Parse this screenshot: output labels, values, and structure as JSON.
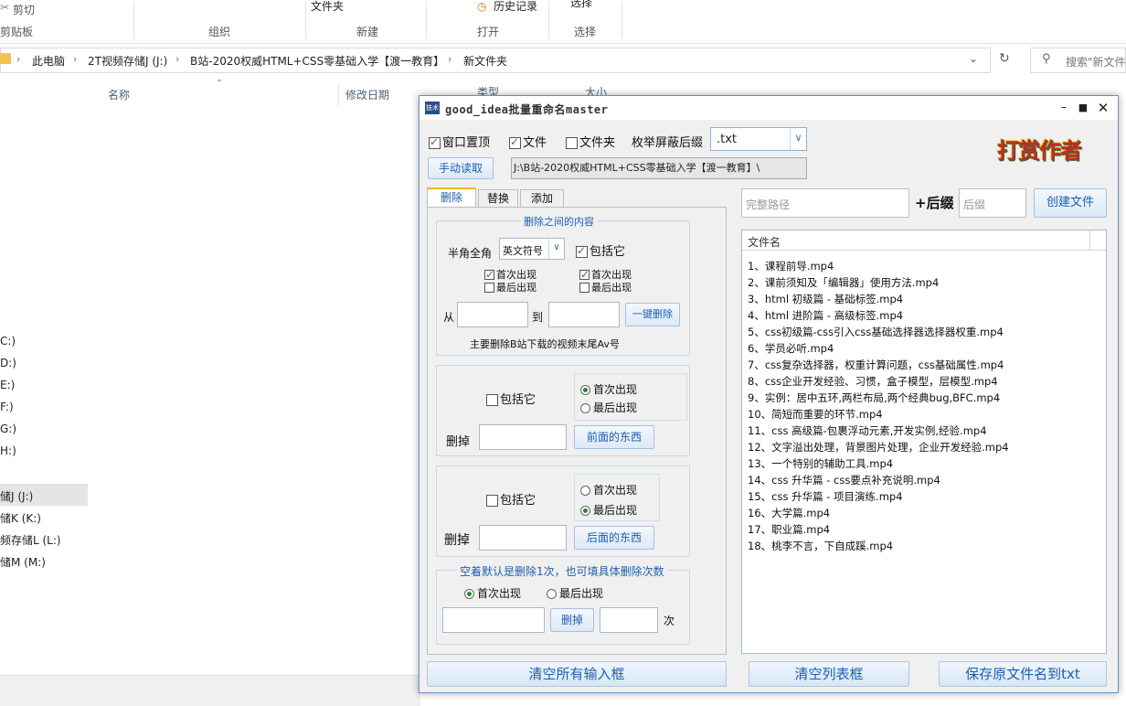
{
  "ribbon": {
    "cut": "剪切",
    "folder": "文件夹",
    "history": "历史记录",
    "select_all": "选择",
    "groups": [
      "剪贴板",
      "组织",
      "新建",
      "打开",
      "选择"
    ]
  },
  "address": {
    "crumbs": [
      "此电脑",
      "2T视频存储J (J:)",
      "B站-2020权威HTML+CSS零基础入学【渡一教育】",
      "新文件夹"
    ],
    "search_placeholder": "搜索\"新文件"
  },
  "columns": {
    "name": "名称",
    "modified": "修改日期",
    "type": "类型",
    "size": "大小"
  },
  "drives": [
    "C:)",
    "D:)",
    "E:)",
    "F:)",
    "G:)",
    "H:)",
    "储J (J:)",
    "储K (K:)",
    "频存储L (L:)",
    "储M (M:)"
  ],
  "window": {
    "title": "good_idea批量重命名master",
    "icon_text": "技术",
    "pin_label": "窗口置顶",
    "file_label": "文件",
    "folder_label": "文件夹",
    "suffix_label": "枚举屏蔽后缀",
    "suffix_value": ".txt",
    "manual_read": "手动读取",
    "path_value": "J:\\B站-2020权威HTML+CSS零基础入学【渡一教育】\\",
    "reward_label": "打赏作者",
    "full_path_placeholder": "完整路径",
    "plus_suffix": "+后缀",
    "suffix_placeholder": "后缀",
    "create_file": "创建文件",
    "tabs": [
      "删除",
      "替换",
      "添加"
    ],
    "g1": {
      "title": "删除之间的内容",
      "half_full": "半角全角",
      "symbol_option": "英文符号",
      "include_it": "包括它",
      "first1": "首次出现",
      "last1": "最后出现",
      "first2": "首次出现",
      "last2": "最后出现",
      "from": "从",
      "to": "到",
      "one_click": "一键删除",
      "note": "主要删除B站下载的视频末尾Av号"
    },
    "g2": {
      "include_it": "包括它",
      "first": "首次出现",
      "last": "最后出现",
      "delete": "删掉",
      "button": "前面的东西"
    },
    "g3": {
      "include_it": "包括它",
      "first": "首次出现",
      "last": "最后出现",
      "delete": "删掉",
      "button": "后面的东西"
    },
    "g4": {
      "title": "空着默认是删除1次，也可填具体删除次数",
      "first": "首次出现",
      "last": "最后出现",
      "button": "删掉",
      "times": "次"
    },
    "list_header": "文件名",
    "files": [
      "1、课程前导.mp4",
      "2、课前须知及「编辑器」使用方法.mp4",
      "3、html 初级篇 - 基础标签.mp4",
      "4、html 进阶篇 - 高级标签.mp4",
      "5、css初级篇-css引入css基础选择器选择器权重.mp4",
      "6、学员必听.mp4",
      "7、css复杂选择器，权重计算问题，css基础属性.mp4",
      "8、css企业开发经验、习惯，盒子模型，层模型.mp4",
      "9、实例：居中五环,两栏布局,两个经典bug,BFC.mp4",
      "10、简短而重要的环节.mp4",
      "11、css 高级篇-包裹浮动元素,开发实例,经验.mp4",
      "12、文字溢出处理，背景图片处理，企业开发经验.mp4",
      "13、一个特别的辅助工具.mp4",
      "14、css 升华篇 - css要点补充说明.mp4",
      "15、css 升华篇 - 项目演练.mp4",
      "16、大学篇.mp4",
      "17、职业篇.mp4",
      "18、桃李不言，下自成蹊.mp4"
    ],
    "clear_inputs": "清空所有输入框",
    "clear_list": "清空列表框",
    "save_txt": "保存原文件名到txt"
  }
}
